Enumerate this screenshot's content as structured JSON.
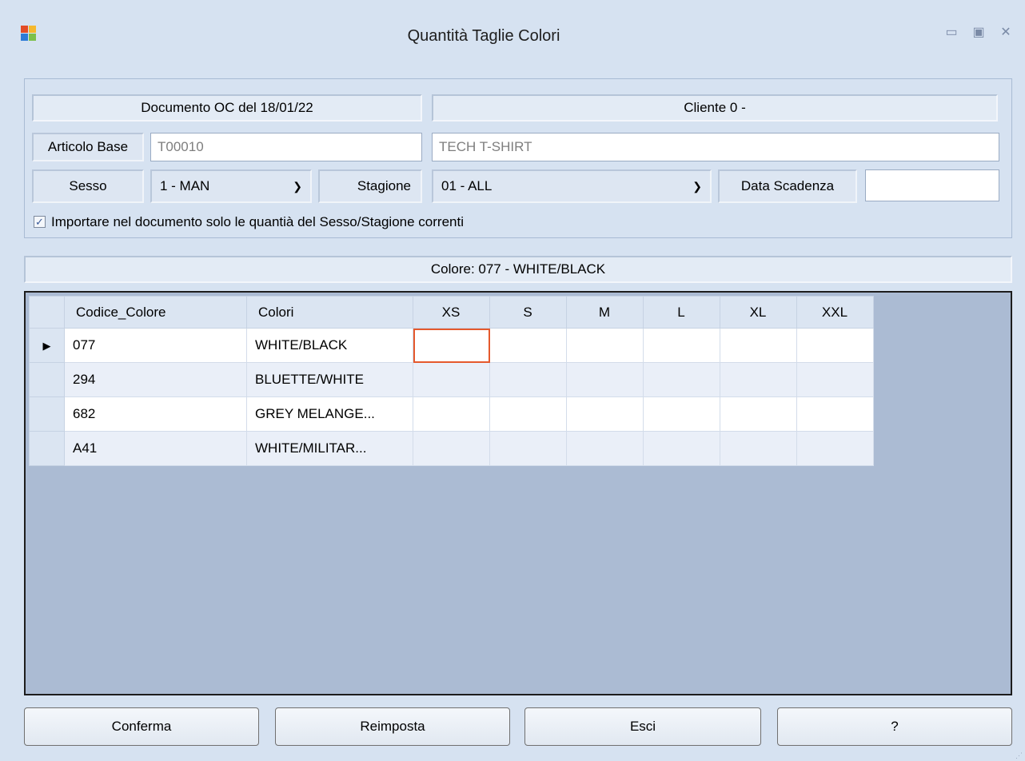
{
  "window": {
    "title": "Quantità Taglie Colori",
    "controls": {
      "minimize": "▭",
      "maximize": "▣",
      "close": "✕"
    }
  },
  "header": {
    "documento": "Documento OC del 18/01/22",
    "cliente": "Cliente 0 -",
    "articolo_label": "Articolo Base",
    "articolo_code": "T00010",
    "articolo_desc": "TECH T-SHIRT",
    "sesso_label": "Sesso",
    "sesso_value": "1 - MAN",
    "stagione_label": "Stagione",
    "stagione_value": "01 - ALL",
    "scadenza_label": "Data Scadenza",
    "scadenza_value": ""
  },
  "import_checkbox": {
    "checked": true,
    "label": "Importare nel documento solo le quantià del Sesso/Stagione correnti"
  },
  "color_bar": "Colore: 077 - WHITE/BLACK",
  "grid": {
    "columns": [
      "Codice_Colore",
      "Colori",
      "XS",
      "S",
      "M",
      "L",
      "XL",
      "XXL"
    ],
    "rows": [
      {
        "code": "077",
        "color": "WHITE/BLACK",
        "qty": [
          "",
          "",
          "",
          "",
          "",
          ""
        ]
      },
      {
        "code": "294",
        "color": "BLUETTE/WHITE",
        "qty": [
          "",
          "",
          "",
          "",
          "",
          ""
        ]
      },
      {
        "code": "682",
        "color": "GREY MELANGE...",
        "qty": [
          "",
          "",
          "",
          "",
          "",
          ""
        ]
      },
      {
        "code": "A41",
        "color": "WHITE/MILITAR...",
        "qty": [
          "",
          "",
          "",
          "",
          "",
          ""
        ]
      }
    ],
    "current_row_marker": "▶"
  },
  "buttons": {
    "confirm": "Conferma",
    "reset": "Reimposta",
    "exit": "Esci",
    "help": "?"
  },
  "icons": {
    "dropdown": "chevron-down-icon",
    "app": "app-icon",
    "check": "checkmark-icon"
  },
  "colors": {
    "window_bg": "#d6e2f1",
    "grid_bg": "#abbbd3",
    "active_cell": "#e5592d"
  }
}
